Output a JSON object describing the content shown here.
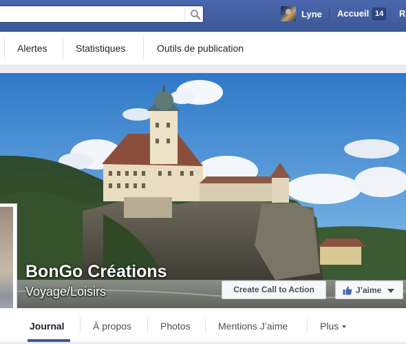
{
  "topbar": {
    "search": {
      "placeholder": "",
      "icon": "search-icon"
    },
    "profile_name": "Lyne",
    "home_label": "Accueil",
    "home_count": "14",
    "cut_label": "R"
  },
  "admin_nav": {
    "tabs": [
      "Alertes",
      "Statistiques",
      "Outils de publication"
    ]
  },
  "page": {
    "name": "BonGo Créations",
    "category": "Voyage/Loisirs",
    "cta_label": "Create Call to Action",
    "like_label": "J’aime"
  },
  "timeline_tabs": {
    "items": [
      "Journal",
      "À propos",
      "Photos",
      "Mentions J’aime",
      "Plus"
    ],
    "active": "Journal"
  },
  "colors": {
    "brand": "#3b5998",
    "topbar": "#4267b2",
    "text": "#1d2129"
  }
}
